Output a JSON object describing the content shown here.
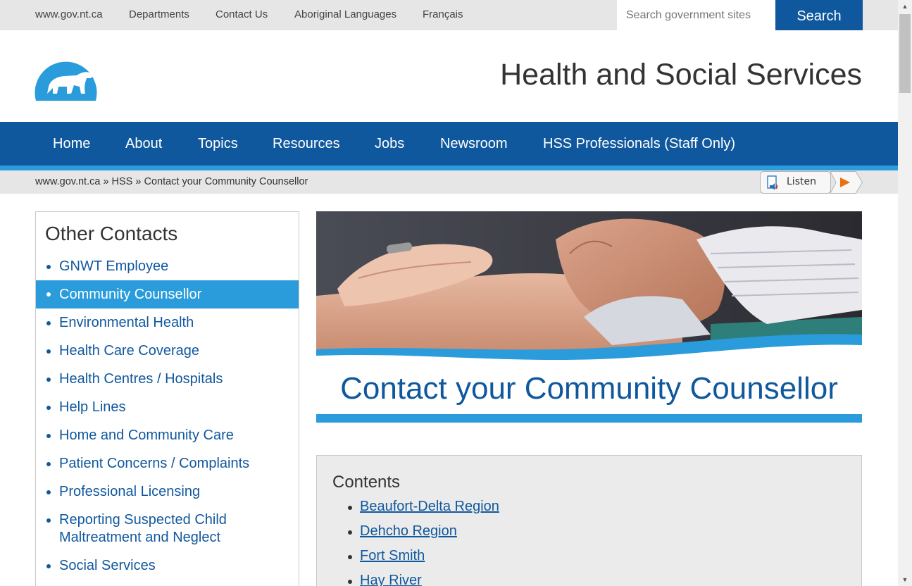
{
  "topbar": {
    "links": [
      "www.gov.nt.ca",
      "Departments",
      "Contact Us",
      "Aboriginal Languages",
      "Français"
    ],
    "search_placeholder": "Search government sites",
    "search_button": "Search"
  },
  "header": {
    "title": "Health and Social Services",
    "logo_icon": "polar-bear-logo"
  },
  "nav": {
    "items": [
      "Home",
      "About",
      "Topics",
      "Resources",
      "Jobs",
      "Newsroom",
      "HSS Professionals (Staff Only)"
    ]
  },
  "breadcrumb": {
    "text": "www.gov.nt.ca » HSS » Contact your Community Counsellor",
    "listen_label": "Listen"
  },
  "sidebar": {
    "title": "Other Contacts",
    "active_index": 1,
    "items": [
      "GNWT Employee",
      "Community Counsellor",
      "Environmental Health",
      "Health Care Coverage",
      "Health Centres / Hospitals",
      "Help Lines",
      "Home and Community Care",
      "Patient Concerns / Complaints",
      "Professional Licensing",
      "Reporting Suspected Child Maltreatment and Neglect",
      "Social Services"
    ]
  },
  "main": {
    "page_title": "Contact your Community Counsellor",
    "contents_title": "Contents",
    "contents_links": [
      "Beaufort-Delta Region",
      "Dehcho Region",
      "Fort Smith",
      "Hay River"
    ]
  },
  "colors": {
    "primary": "#10589e",
    "accent": "#2a9bdb",
    "bar_gray": "#e6e6e6"
  }
}
